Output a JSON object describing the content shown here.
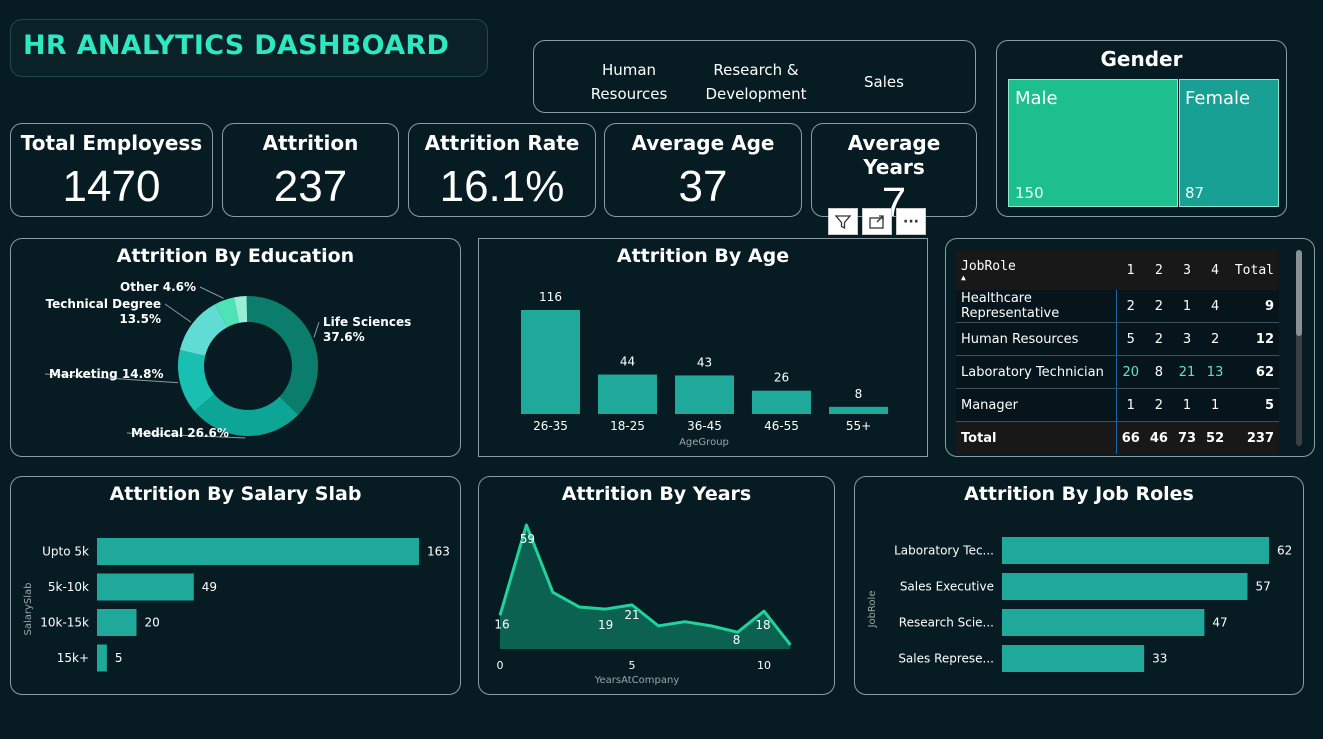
{
  "dashboard": {
    "title": "HR ANALYTICS DASHBOARD"
  },
  "department_slicer": {
    "items": [
      {
        "line1": "Human",
        "line2": "Resources"
      },
      {
        "line1": "Research &",
        "line2": "Development"
      },
      {
        "line1": "Sales",
        "line2": ""
      }
    ]
  },
  "kpis": {
    "total_employees": {
      "label": "Total Employess",
      "value": "1470"
    },
    "attrition": {
      "label": "Attrition",
      "value": "237"
    },
    "attrition_rate": {
      "label": "Attrition Rate",
      "value": "16.1%"
    },
    "average_age": {
      "label": "Average Age",
      "value": "37"
    },
    "average_years": {
      "label_line1": "Average",
      "label_line2": "Years",
      "value": "7"
    }
  },
  "visual_toolbar": {
    "icons": [
      "filter-icon",
      "focus-mode-icon",
      "more-options-icon"
    ],
    "more_label": "···"
  },
  "gender": {
    "title": "Gender",
    "male_label": "Male",
    "male_value": "150",
    "female_label": "Female",
    "female_value": "87",
    "colors": {
      "male": "#1dbf8e",
      "female": "#17a093"
    }
  },
  "matrix": {
    "header": [
      "JobRole",
      "1",
      "2",
      "3",
      "4",
      "Total"
    ],
    "rows": [
      {
        "role": "Healthcare Representative",
        "v1": "2",
        "v2": "2",
        "v3": "1",
        "v4": "4",
        "total": "9"
      },
      {
        "role": "Human Resources",
        "v1": "5",
        "v2": "2",
        "v3": "3",
        "v4": "2",
        "total": "12"
      },
      {
        "role": "Laboratory Technician",
        "v1": "20",
        "v2": "8",
        "v3": "21",
        "v4": "13",
        "total": "62"
      },
      {
        "role": "Manager",
        "v1": "1",
        "v2": "2",
        "v3": "1",
        "v4": "1",
        "total": "5"
      }
    ],
    "total_row": {
      "role": "Total",
      "v1": "66",
      "v2": "46",
      "v3": "73",
      "v4": "52",
      "total": "237"
    }
  },
  "chart_data": [
    {
      "type": "pie",
      "title": "Attrition By Education",
      "slices": [
        {
          "name": "Life Sciences",
          "label": "37.6%",
          "value": 37.6,
          "color": "#0b7d6c"
        },
        {
          "name": "Medical",
          "label": "26.6%",
          "value": 26.6,
          "color": "#0da596"
        },
        {
          "name": "Marketing",
          "label": "14.8%",
          "value": 14.8,
          "color": "#19c0b1"
        },
        {
          "name": "Technical Degree",
          "label": "13.5%",
          "value": 13.5,
          "color": "#61dcd4"
        },
        {
          "name": "Other",
          "label": "4.6%",
          "value": 4.6,
          "color": "#4ee3b6"
        },
        {
          "name": "",
          "label": "",
          "value": 2.9,
          "color": "#9aeed8"
        }
      ]
    },
    {
      "type": "bar",
      "title": "Attrition By Age",
      "xlabel": "AgeGroup",
      "categories": [
        "26-35",
        "18-25",
        "36-45",
        "46-55",
        "55+"
      ],
      "values": [
        116,
        44,
        43,
        26,
        8
      ],
      "color": "#1fa99a"
    },
    {
      "type": "bar",
      "orientation": "horizontal",
      "title": "Attrition By Salary Slab",
      "ylabel": "SalarySlab",
      "categories": [
        "Upto 5k",
        "5k-10k",
        "10k-15k",
        "15k+"
      ],
      "values": [
        163,
        49,
        20,
        5
      ],
      "color": "#1fa99a"
    },
    {
      "type": "area",
      "title": "Attrition By Years",
      "xlabel": "YearsAtCompany",
      "x": [
        0,
        1,
        2,
        3,
        4,
        5,
        6,
        7,
        8,
        9,
        10,
        11
      ],
      "y": [
        16,
        59,
        27,
        20,
        19,
        21,
        11,
        13,
        11,
        8,
        18,
        2
      ],
      "point_labels": [
        {
          "x": 0,
          "label": "16"
        },
        {
          "x": 1,
          "label": "59"
        },
        {
          "x": 4,
          "label": "19"
        },
        {
          "x": 5,
          "label": "21"
        },
        {
          "x": 9,
          "label": "8"
        },
        {
          "x": 10,
          "label": "18"
        }
      ],
      "xticks": [
        0,
        5,
        10
      ],
      "line_color": "#1fd39b",
      "fill_color": "#0c6251"
    },
    {
      "type": "bar",
      "orientation": "horizontal",
      "title": "Attrition By Job Roles",
      "ylabel": "JobRole",
      "categories": [
        "Laboratory Tec...",
        "Sales Executive",
        "Research Scie...",
        "Sales Represe..."
      ],
      "values": [
        62,
        57,
        47,
        33
      ],
      "color": "#1fa99a"
    }
  ]
}
